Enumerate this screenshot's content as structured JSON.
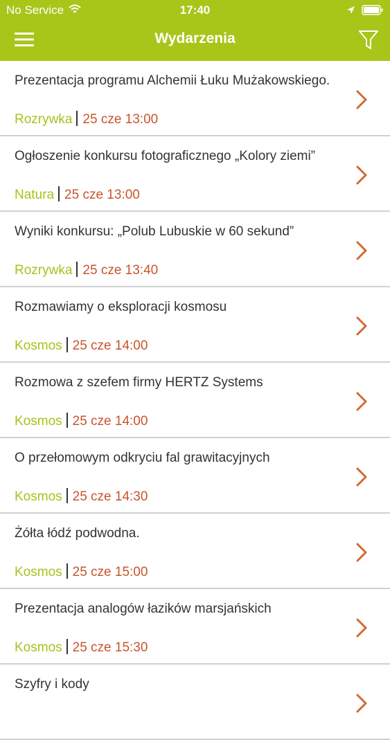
{
  "status": {
    "carrier": "No Service",
    "time": "17:40"
  },
  "header": {
    "title": "Wydarzenia"
  },
  "colors": {
    "bar": "#a8c51a",
    "category": "#a6c21c",
    "time": "#c8542b",
    "chevron": "#d2692e"
  },
  "icons": [
    "wifi-icon",
    "location-icon",
    "battery-icon",
    "menu-icon",
    "filter-icon",
    "chevron-right-icon"
  ],
  "events": [
    {
      "title": "Prezentacja programu Alchemii Łuku Mużakowskiego.",
      "category": "Rozrywka",
      "time": "25 cze 13:00"
    },
    {
      "title": "Ogłoszenie konkursu fotograficznego „Kolory ziemi”",
      "category": "Natura",
      "time": "25 cze 13:00"
    },
    {
      "title": "Wyniki konkursu: „Polub Lubuskie w 60 sekund”",
      "category": "Rozrywka",
      "time": "25 cze 13:40"
    },
    {
      "title": "Rozmawiamy o eksploracji kosmosu",
      "category": "Kosmos",
      "time": "25 cze 14:00"
    },
    {
      "title": "Rozmowa z szefem firmy HERTZ Systems",
      "category": "Kosmos",
      "time": "25 cze 14:00"
    },
    {
      "title": "O przełomowym odkryciu fal grawitacyjnych",
      "category": "Kosmos",
      "time": "25 cze 14:30"
    },
    {
      "title": "Żółta łódź podwodna.",
      "category": "Kosmos",
      "time": "25 cze 15:00"
    },
    {
      "title": "Prezentacja analogów łazików marsjańskich",
      "category": "Kosmos",
      "time": "25 cze 15:30"
    },
    {
      "title": "Szyfry i kody",
      "category": "",
      "time": ""
    }
  ]
}
